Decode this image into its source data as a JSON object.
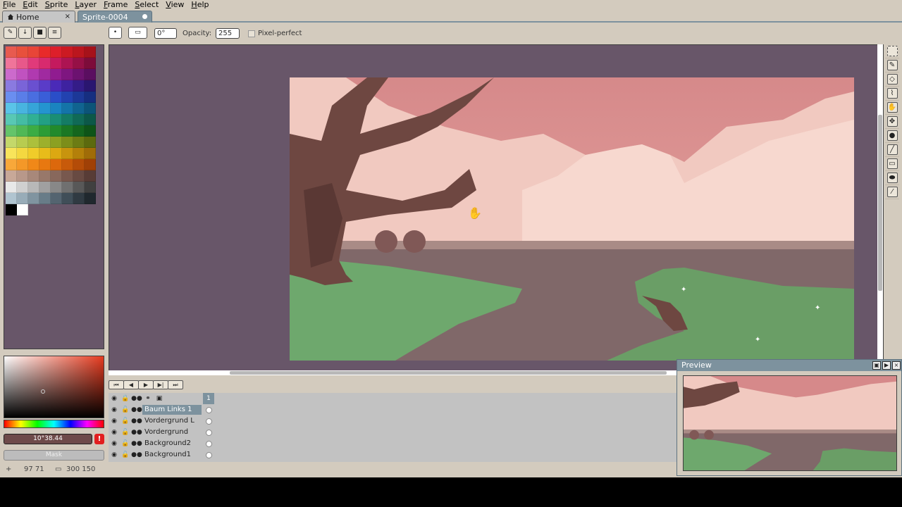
{
  "menu": [
    "File",
    "Edit",
    "Sprite",
    "Layer",
    "Frame",
    "Select",
    "View",
    "Help"
  ],
  "tabs": {
    "home": "Home",
    "home_close": "×",
    "sprite": "Sprite-0004"
  },
  "context_bar": {
    "brush_angle": "0°",
    "opacity_label": "Opacity:",
    "opacity_value": "255",
    "pixel_perfect_label": "Pixel-perfect"
  },
  "palette": {
    "swatches": [
      "#e85a4f",
      "#e8503c",
      "#e84538",
      "#e82a2a",
      "#dd1f2a",
      "#cc1a22",
      "#bb161e",
      "#a6121a",
      "#f0749a",
      "#e8588a",
      "#e03a7a",
      "#d82a6e",
      "#c41a5e",
      "#ad1452",
      "#961046",
      "#7d0c3a",
      "#cc6acc",
      "#c052c0",
      "#b03ab0",
      "#a02aa0",
      "#901c90",
      "#7e1680",
      "#6c1270",
      "#5a0e60",
      "#8a7ae0",
      "#7a64d8",
      "#6a50d0",
      "#5a3cc8",
      "#4a2ab8",
      "#3e22a0",
      "#341c88",
      "#2a1670",
      "#6a8ef0",
      "#5a7ee8",
      "#4a6ee0",
      "#3a5ed8",
      "#2a4ec8",
      "#2242b0",
      "#1c3898",
      "#162e80",
      "#5ac4e8",
      "#48b4e0",
      "#36a4d8",
      "#2494d0",
      "#1a84c0",
      "#1474a8",
      "#106490",
      "#0c5478",
      "#58c8b4",
      "#44bca4",
      "#30b094",
      "#22a084",
      "#1a8e74",
      "#147c64",
      "#106a56",
      "#0c5848",
      "#64c46a",
      "#50b856",
      "#3cac44",
      "#2c9c36",
      "#228a2c",
      "#1a7824",
      "#14661e",
      "#0e5418",
      "#c4d86a",
      "#b8cc50",
      "#acc03c",
      "#9cb02c",
      "#8ca022",
      "#7c8e1a",
      "#6c7c14",
      "#5c6a0e",
      "#f8e45a",
      "#f4d840",
      "#f0cc2a",
      "#e8bc1a",
      "#dca812",
      "#c8940e",
      "#b4800a",
      "#a06c08",
      "#f8a83a",
      "#f49828",
      "#f08818",
      "#e87810",
      "#dc680c",
      "#c85a0a",
      "#b44c08",
      "#a04006",
      "#c8a898",
      "#b8988a",
      "#a8887a",
      "#98786a",
      "#88685c",
      "#78584e",
      "#684a42",
      "#583c36",
      "#e8e8e8",
      "#d0d0d0",
      "#b8b8b8",
      "#a0a0a0",
      "#888888",
      "#707070",
      "#585858",
      "#404040",
      "#b0c4d0",
      "#98acb8",
      "#8094a0",
      "#687c88",
      "#546470",
      "#404e58",
      "#303a42",
      "#20282e",
      "#000000",
      "#ffffff"
    ]
  },
  "color": {
    "value": "10°38.44",
    "warning": "!",
    "mask_label": "Mask"
  },
  "status": {
    "cursor_pos": "97 71",
    "sprite_size": "300 150"
  },
  "timeline": {
    "controls": [
      "first-frame",
      "prev-frame",
      "play",
      "next-frame",
      "last-frame"
    ],
    "frame_number": "1",
    "layers": [
      {
        "name": "Baum Links 1",
        "active": true
      },
      {
        "name": "Vordergrund L",
        "active": false
      },
      {
        "name": "Vordergrund",
        "active": false
      },
      {
        "name": "Background2",
        "active": false
      },
      {
        "name": "Background1",
        "active": false
      }
    ]
  },
  "preview": {
    "title": "Preview"
  },
  "tools": [
    "rectangular-marquee-icon",
    "pencil-icon",
    "eraser-icon",
    "eyedropper-icon",
    "hand-icon",
    "move-icon",
    "paint-bucket-icon",
    "line-icon",
    "rectangle-icon",
    "ellipse-icon",
    "blur-icon"
  ],
  "colors": {
    "chrome": "#d3cbbe",
    "accent": "#7d929e",
    "workspace": "#685669"
  }
}
